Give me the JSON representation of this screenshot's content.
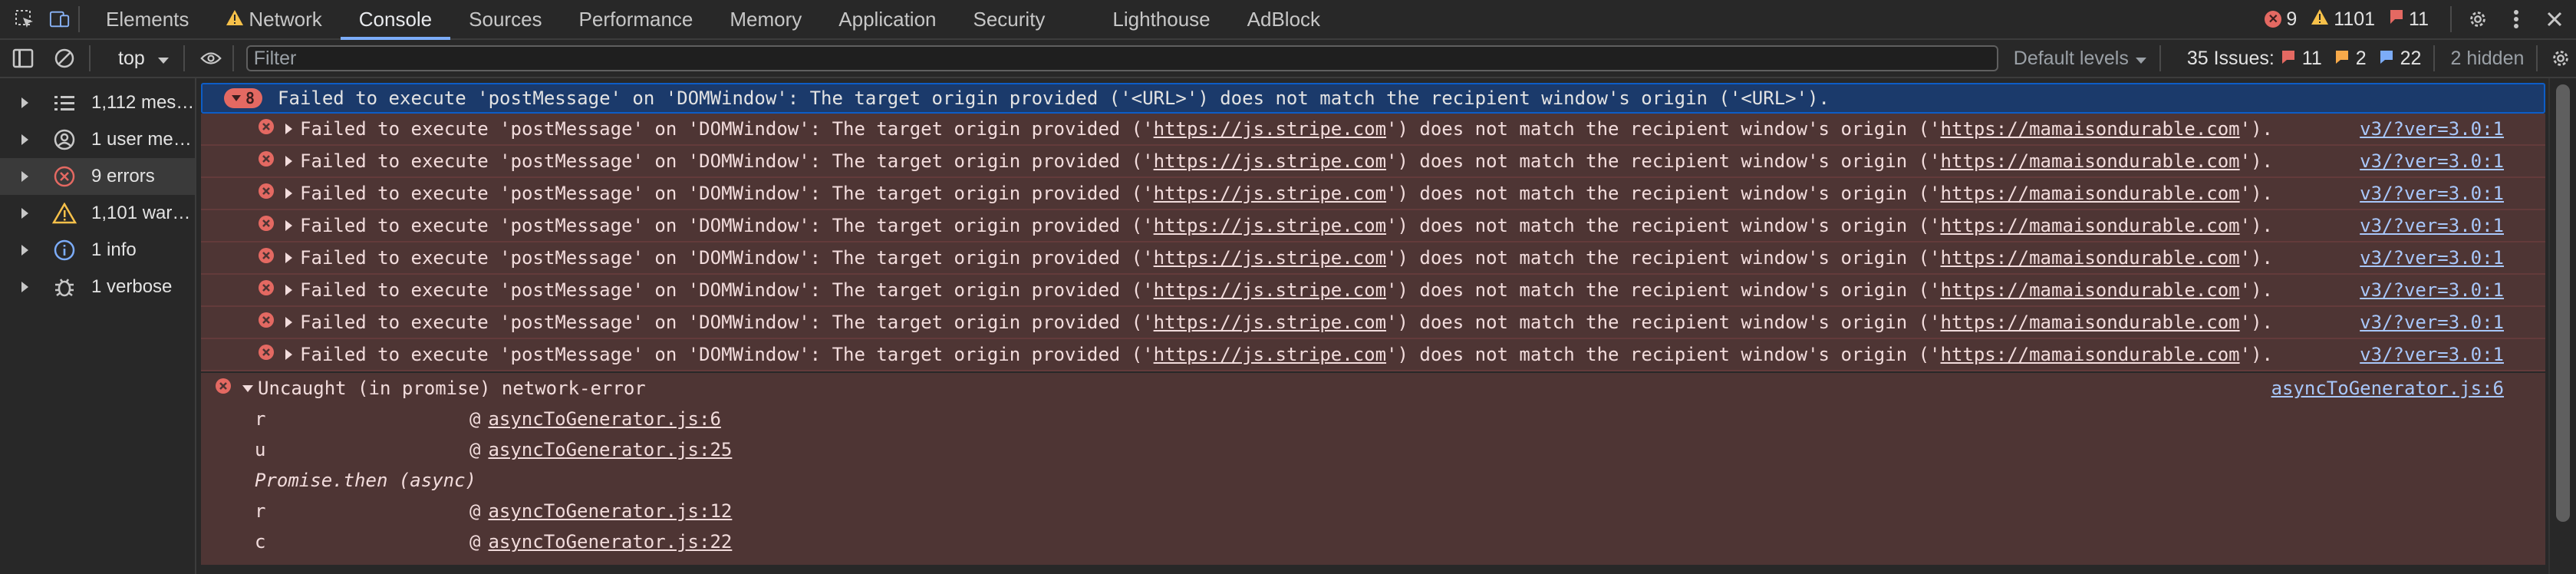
{
  "tabs": [
    "Elements",
    "Network",
    "Console",
    "Sources",
    "Performance",
    "Memory",
    "Application",
    "Security",
    "Lighthouse",
    "AdBlock"
  ],
  "active_tab": "Console",
  "counts": {
    "errors": "9",
    "warnings": "1101",
    "issues": "11"
  },
  "toolbar": {
    "context": "top",
    "filter_placeholder": "Filter",
    "levels_label": "Default levels",
    "issues_label": "35 Issues:",
    "issues_errors": "11",
    "issues_warnings": "2",
    "issues_info": "22",
    "hidden_label": "2 hidden"
  },
  "sidebar": {
    "items": [
      {
        "label": "1,112 mes…",
        "icon": "list-icon"
      },
      {
        "label": "1 user me…",
        "icon": "user-icon"
      },
      {
        "label": "9 errors",
        "icon": "error-icon"
      },
      {
        "label": "1,101 war…",
        "icon": "warning-icon"
      },
      {
        "label": "1 info",
        "icon": "info-icon"
      },
      {
        "label": "1 verbose",
        "icon": "bug-icon"
      }
    ]
  },
  "group": {
    "count": "8",
    "message": "Failed to execute 'postMessage' on 'DOMWindow': The target origin provided ('<URL>') does not match the recipient window's origin ('<URL>')."
  },
  "error_rows": [
    {
      "pre": "Failed to execute 'postMessage' on 'DOMWindow': The target origin provided ('",
      "link1": "https://js.stripe.com",
      "mid": "') does not match the recipient window's origin ('",
      "link2": "https://mamaisondurable.com",
      "post": "').",
      "source": "v3/?ver=3.0:1"
    },
    {
      "pre": "Failed to execute 'postMessage' on 'DOMWindow': The target origin provided ('",
      "link1": "https://js.stripe.com",
      "mid": "') does not match the recipient window's origin ('",
      "link2": "https://mamaisondurable.com",
      "post": "').",
      "source": "v3/?ver=3.0:1"
    },
    {
      "pre": "Failed to execute 'postMessage' on 'DOMWindow': The target origin provided ('",
      "link1": "https://js.stripe.com",
      "mid": "') does not match the recipient window's origin ('",
      "link2": "https://mamaisondurable.com",
      "post": "').",
      "source": "v3/?ver=3.0:1"
    },
    {
      "pre": "Failed to execute 'postMessage' on 'DOMWindow': The target origin provided ('",
      "link1": "https://js.stripe.com",
      "mid": "') does not match the recipient window's origin ('",
      "link2": "https://mamaisondurable.com",
      "post": "').",
      "source": "v3/?ver=3.0:1"
    },
    {
      "pre": "Failed to execute 'postMessage' on 'DOMWindow': The target origin provided ('",
      "link1": "https://js.stripe.com",
      "mid": "') does not match the recipient window's origin ('",
      "link2": "https://mamaisondurable.com",
      "post": "').",
      "source": "v3/?ver=3.0:1"
    },
    {
      "pre": "Failed to execute 'postMessage' on 'DOMWindow': The target origin provided ('",
      "link1": "https://js.stripe.com",
      "mid": "') does not match the recipient window's origin ('",
      "link2": "https://mamaisondurable.com",
      "post": "').",
      "source": "v3/?ver=3.0:1"
    },
    {
      "pre": "Failed to execute 'postMessage' on 'DOMWindow': The target origin provided ('",
      "link1": "https://js.stripe.com",
      "mid": "') does not match the recipient window's origin ('",
      "link2": "https://mamaisondurable.com",
      "post": "').",
      "source": "v3/?ver=3.0:1"
    },
    {
      "pre": "Failed to execute 'postMessage' on 'DOMWindow': The target origin provided ('",
      "link1": "https://js.stripe.com",
      "mid": "') does not match the recipient window's origin ('",
      "link2": "https://mamaisondurable.com",
      "post": "').",
      "source": "v3/?ver=3.0:1"
    }
  ],
  "uncaught": {
    "message": "Uncaught (in promise) network-error",
    "source": "asyncToGenerator.js:6",
    "stack": [
      {
        "fn": "r",
        "at": "@",
        "loc": "asyncToGenerator.js:6"
      },
      {
        "fn": "u",
        "at": "@",
        "loc": "asyncToGenerator.js:25"
      },
      {
        "async": "Promise.then (async)"
      },
      {
        "fn": "r",
        "at": "@",
        "loc": "asyncToGenerator.js:12"
      },
      {
        "fn": "c",
        "at": "@",
        "loc": "asyncToGenerator.js:22"
      }
    ]
  },
  "colors": {
    "accent": "#7cacf8",
    "error": "#e46962",
    "warning": "#f7c14a",
    "error_row_bg": "#4e3534",
    "group_bg": "#1b3a6b"
  }
}
